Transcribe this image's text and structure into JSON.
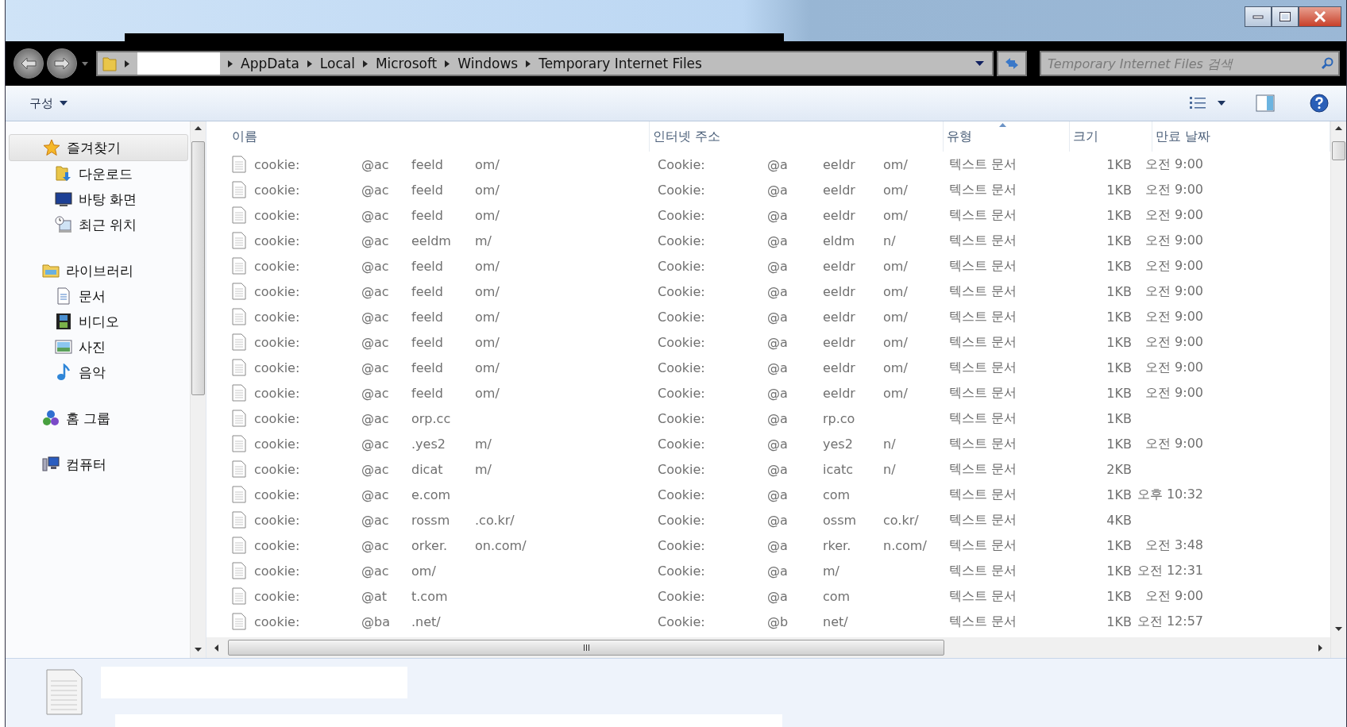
{
  "address_bar": {
    "crumbs": [
      "AppData",
      "Local",
      "Microsoft",
      "Windows",
      "Temporary Internet Files"
    ]
  },
  "search": {
    "placeholder": "Temporary Internet Files 검색"
  },
  "command_bar": {
    "organize": "구성"
  },
  "sidebar": {
    "groups": [
      {
        "label": "즐겨찾기",
        "kind": "star",
        "selected": true,
        "children": [
          {
            "label": "다운로드",
            "kind": "download",
            "selected": false
          },
          {
            "label": "바탕 화면",
            "kind": "desktop",
            "selected": false
          },
          {
            "label": "최근 위치",
            "kind": "recent",
            "selected": false
          }
        ]
      },
      {
        "label": "라이브러리",
        "kind": "library",
        "selected": false,
        "children": [
          {
            "label": "문서",
            "kind": "document",
            "selected": false
          },
          {
            "label": "비디오",
            "kind": "video",
            "selected": false
          },
          {
            "label": "사진",
            "kind": "picture",
            "selected": false
          },
          {
            "label": "음악",
            "kind": "music",
            "selected": false
          }
        ]
      },
      {
        "label": "홈 그룹",
        "kind": "homegroup",
        "selected": false
      },
      {
        "label": "컴퓨터",
        "kind": "computer",
        "selected": false
      }
    ]
  },
  "table": {
    "columns": [
      {
        "label": "이름",
        "sorted": false
      },
      {
        "label": "인터넷 주소",
        "sorted": false
      },
      {
        "label": "유형",
        "sorted": true
      },
      {
        "label": "크기",
        "sorted": false
      },
      {
        "label": "만료 날짜",
        "sorted": false
      }
    ],
    "rows": [
      {
        "name": [
          "cookie:",
          "@ac",
          "feeld",
          "om/"
        ],
        "address": [
          "Cookie:",
          "@a",
          "eeldr",
          "om/"
        ],
        "type": "텍스트 문서",
        "size": "1KB",
        "expires": "오전 9:00"
      },
      {
        "name": [
          "cookie:",
          "@ac",
          "feeld",
          "om/"
        ],
        "address": [
          "Cookie:",
          "@a",
          "eeldr",
          "om/"
        ],
        "type": "텍스트 문서",
        "size": "1KB",
        "expires": "오전 9:00"
      },
      {
        "name": [
          "cookie:",
          "@ac",
          "feeld",
          "om/"
        ],
        "address": [
          "Cookie:",
          "@a",
          "eeldr",
          "om/"
        ],
        "type": "텍스트 문서",
        "size": "1KB",
        "expires": "오전 9:00"
      },
      {
        "name": [
          "cookie:",
          "@ac",
          "eeldm",
          "m/"
        ],
        "address": [
          "Cookie:",
          "@a",
          "eldm",
          "n/"
        ],
        "type": "텍스트 문서",
        "size": "1KB",
        "expires": "오전 9:00"
      },
      {
        "name": [
          "cookie:",
          "@ac",
          "feeld",
          "om/"
        ],
        "address": [
          "Cookie:",
          "@a",
          "eeldr",
          "om/"
        ],
        "type": "텍스트 문서",
        "size": "1KB",
        "expires": "오전 9:00"
      },
      {
        "name": [
          "cookie:",
          "@ac",
          "feeld",
          "om/"
        ],
        "address": [
          "Cookie:",
          "@a",
          "eeldr",
          "om/"
        ],
        "type": "텍스트 문서",
        "size": "1KB",
        "expires": "오전 9:00"
      },
      {
        "name": [
          "cookie:",
          "@ac",
          "feeld",
          "om/"
        ],
        "address": [
          "Cookie:",
          "@a",
          "eeldr",
          "om/"
        ],
        "type": "텍스트 문서",
        "size": "1KB",
        "expires": "오전 9:00"
      },
      {
        "name": [
          "cookie:",
          "@ac",
          "feeld",
          "om/"
        ],
        "address": [
          "Cookie:",
          "@a",
          "eeldr",
          "om/"
        ],
        "type": "텍스트 문서",
        "size": "1KB",
        "expires": "오전 9:00"
      },
      {
        "name": [
          "cookie:",
          "@ac",
          "feeld",
          "om/"
        ],
        "address": [
          "Cookie:",
          "@a",
          "eeldr",
          "om/"
        ],
        "type": "텍스트 문서",
        "size": "1KB",
        "expires": "오전 9:00"
      },
      {
        "name": [
          "cookie:",
          "@ac",
          "feeld",
          "om/"
        ],
        "address": [
          "Cookie:",
          "@a",
          "eeldr",
          "om/"
        ],
        "type": "텍스트 문서",
        "size": "1KB",
        "expires": "오전 9:00"
      },
      {
        "name": [
          "cookie:",
          "@ac",
          "orp.cc"
        ],
        "address": [
          "Cookie:",
          "@a",
          "rp.co"
        ],
        "type": "텍스트 문서",
        "size": "1KB"
      },
      {
        "name": [
          "cookie:",
          "@ac",
          ".yes2",
          "m/"
        ],
        "address": [
          "Cookie:",
          "@a",
          "yes2",
          "n/"
        ],
        "type": "텍스트 문서",
        "size": "1KB",
        "expires": "오전 9:00"
      },
      {
        "name": [
          "cookie:",
          "@ac",
          "dicat",
          "m/"
        ],
        "address": [
          "Cookie:",
          "@a",
          "icatc",
          "n/"
        ],
        "type": "텍스트 문서",
        "size": "2KB"
      },
      {
        "name": [
          "cookie:",
          "@ac",
          "e.com"
        ],
        "address": [
          "Cookie:",
          "@a",
          "com"
        ],
        "type": "텍스트 문서",
        "size": "1KB",
        "expires": "오후 10:32"
      },
      {
        "name": [
          "cookie:",
          "@ac",
          "rossm",
          ".co.kr/"
        ],
        "address": [
          "Cookie:",
          "@a",
          "ossm",
          "co.kr/"
        ],
        "type": "텍스트 문서",
        "size": "4KB"
      },
      {
        "name": [
          "cookie:",
          "@ac",
          "orker.",
          "on.com/"
        ],
        "address": [
          "Cookie:",
          "@a",
          "rker.",
          "n.com/"
        ],
        "type": "텍스트 문서",
        "size": "1KB",
        "expires": "오전 3:48"
      },
      {
        "name": [
          "cookie:",
          "@ac",
          "om/"
        ],
        "address": [
          "Cookie:",
          "@a",
          "m/"
        ],
        "type": "텍스트 문서",
        "size": "1KB",
        "expires": "오전 12:31"
      },
      {
        "name": [
          "cookie:",
          "@at",
          "t.com"
        ],
        "address": [
          "Cookie:",
          "@a",
          "com"
        ],
        "type": "텍스트 문서",
        "size": "1KB",
        "expires": "오전 9:00"
      },
      {
        "name": [
          "cookie:",
          "@ba",
          ".net/"
        ],
        "address": [
          "Cookie:",
          "@b",
          "net/"
        ],
        "type": "텍스트 문서",
        "size": "1KB",
        "expires": "오전 12:57"
      }
    ]
  }
}
